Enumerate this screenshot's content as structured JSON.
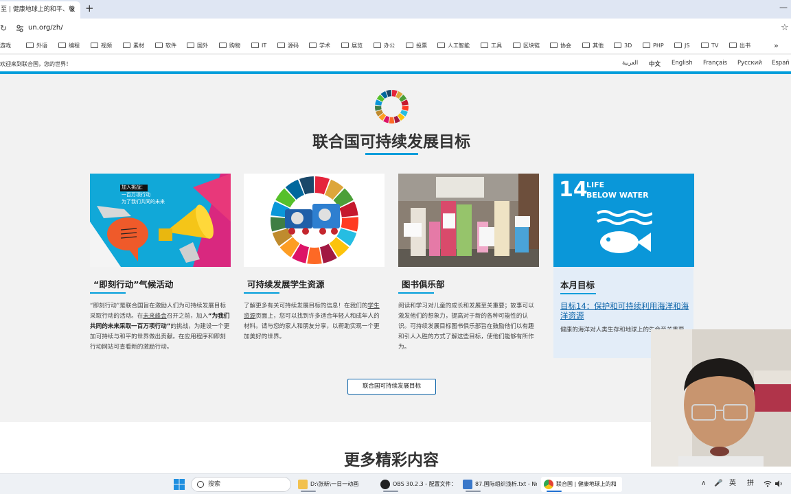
{
  "browser": {
    "tab_title": "至 | 健康地球上的和平、尊",
    "tab_close": "✕",
    "new_tab": "+",
    "minimize": "—",
    "reload": "↻",
    "url": "un.org/zh/",
    "star": "☆",
    "bookmarks": [
      "游戏",
      "外语",
      "编程",
      "视频",
      "素材",
      "软件",
      "国外",
      "购物",
      "IT",
      "源码",
      "学术",
      "展览",
      "办公",
      "投票",
      "人工智能",
      "工具",
      "区块链",
      "协会",
      "其他",
      "3D",
      "PHP",
      "JS",
      "TV",
      "出书"
    ],
    "bookmarks_more": "»"
  },
  "header": {
    "welcome": "欢迎来到联合国，您的世界！",
    "languages": [
      "العربية",
      "中文",
      "English",
      "Français",
      "Русский",
      "Españ"
    ],
    "active_language": "中文"
  },
  "main": {
    "title": "联合国可持续发展目标",
    "cards": [
      {
        "title": "“即刻行动”气候活动",
        "image_text": [
          "加入挑战：",
          "一百万项行动",
          "为了我们共同的未来"
        ],
        "text_1": "“即刻行动”是联合国旨在激励人们为可持续发展目标采取行动的活动。在",
        "text_link": "未来峰会",
        "text_2": "召开之前，加入",
        "text_bold": "“为我们共同的未来采取一百万项行动”",
        "text_3": "的挑战，为建设一个更加可持续与和平的世界做出贡献。在应用程序和即刻行动网站可查看新的激励行动。"
      },
      {
        "title": "可持续发展学生资源",
        "text_1": "了解更多有关可持续发展目标的信息！在我们的",
        "text_link": "学生资源",
        "text_2": "页面上，您可以找到许多适合年轻人和成年人的材料。请与您的家人和朋友分享，以帮助实现一个更加美好的世界。"
      },
      {
        "title": "图书俱乐部",
        "text": "阅读和学习对儿童的成长和发展至关重要；故事可以激发他们的想象力，提高对于新的各种可能性的认识。可持续发展目标图书俱乐部旨在鼓励他们以有趣和引人入胜的方式了解这些目标，使他们能够有所作为。"
      },
      {
        "title": "本月目标",
        "image_number": "14",
        "image_label_1": "LIFE",
        "image_label_2": "BELOW WATER",
        "link": "目标14：保护和可持续利用海洋和海洋资源",
        "text": "健康的海洋对人类生存和地球上的生命至关重要。"
      }
    ],
    "cta": "联合国可持续发展目标"
  },
  "more": {
    "title": "更多精彩内容"
  },
  "taskbar": {
    "search_label": "搜索",
    "apps": [
      {
        "label": "D:\\张新\\一日一动画",
        "color": "#f2c14e"
      },
      {
        "label": "OBS 30.2.3 - 配置文件：无",
        "color": "#222222"
      },
      {
        "label": "87.国际组织浅析.txt - No",
        "color": "#3a78c9"
      },
      {
        "label": "联合国 | 健康地球上的和",
        "color": "#e34234"
      }
    ],
    "tray": [
      "∧",
      "🎤",
      "英",
      "拼"
    ]
  },
  "colors": {
    "un_blue": "#009edb",
    "goal14_blue": "#0a97d9",
    "link_blue": "#0b63a8"
  },
  "sdg_colors": [
    "#e5243b",
    "#dda63a",
    "#4c9f38",
    "#c5192d",
    "#ff3a21",
    "#26bde2",
    "#fcc30b",
    "#a21942",
    "#fd6925",
    "#dd1367",
    "#fd9d24",
    "#bf8b2e",
    "#3f7e44",
    "#0a97d9",
    "#56c02b",
    "#00689d",
    "#19486a"
  ]
}
